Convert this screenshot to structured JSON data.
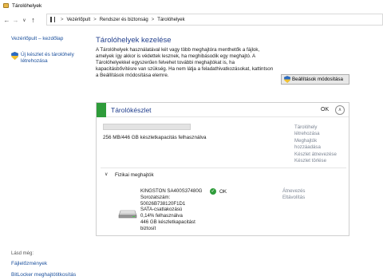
{
  "window": {
    "title": "Tárolóhelyek"
  },
  "address": {
    "crumbs": [
      "Vezérlőpult",
      "Rendszer és biztonság",
      "Tárolóhelyek"
    ],
    "separator": ">"
  },
  "nav": {
    "back_icon": "arrow-left",
    "forward_icon": "arrow-right",
    "recent_icon": "chevron-down",
    "up_icon": "arrow-up"
  },
  "leftpane": {
    "home_link": "Vezérlőpult – kezdőlap",
    "new_pool_link": "Új készlet és tárolóhely létrehozása",
    "see_also": "Lásd még:",
    "links": [
      "Fájlelőzmények",
      "BitLocker meghajtótitkosítás"
    ]
  },
  "main": {
    "title": "Tárolóhelyek kezelése",
    "description": "A Tárolóhelyek használatával két vagy több meghajtóra menthetők a fájlok, amelyek így akkor is védettek lesznek, ha meghibásodik egy meghajtó. A Tárolóhelyekkel egyszerűen felvehet további meghajtókat is, ha kapacitásbővítésre van szükség. Ha nem látja a feladathivatkozásokat, kattintson a Beállítások módosítása elemre.",
    "change_settings_button": "Beállítások módosítása"
  },
  "pool": {
    "title": "Tárolókészlet",
    "status": "OK",
    "capacity_text": "256 MB/446 GB készletkapacitás felhasználva",
    "capacity_used_fraction": 0.0006,
    "actions": [
      "Tárolóhely",
      "létrehozása",
      "Meghajtók",
      "hozzáadása",
      "Készlet átnevezése",
      "Készlet törlése"
    ],
    "physical_label": "Fizikai meghajtók",
    "drive": {
      "name": "KINGSTON SA400S37480G",
      "lines": [
        "Sorozatszám:",
        "50026B738120F1D1",
        "SATA-csatlakozású",
        "0,14% felhasználva",
        "446 GB készletkapacitást",
        "biztosít"
      ],
      "status": "OK",
      "actions": [
        "Átnevezés",
        "Eltávolítás"
      ]
    }
  },
  "colors": {
    "accent_green": "#2e9c3a",
    "link_blue": "#1a4f9c",
    "heading_blue": "#1f3d8c",
    "disabled_grey": "#7c8593"
  }
}
